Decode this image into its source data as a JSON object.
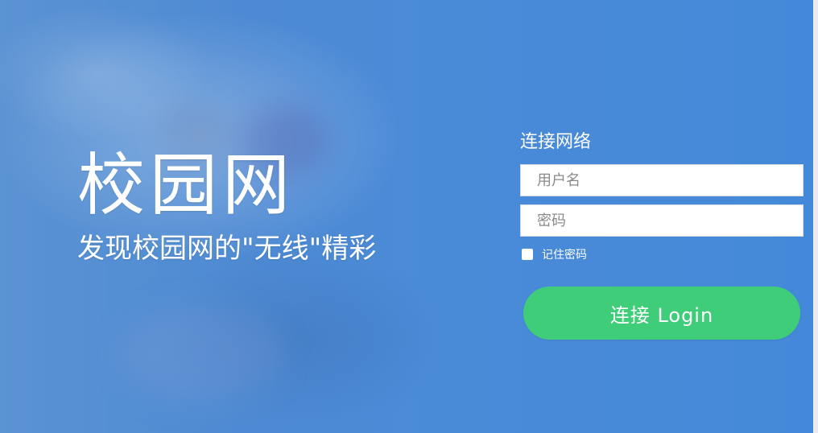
{
  "brand": {
    "title": "校园网",
    "slogan": "发现校园网的\"无线\"精彩"
  },
  "login": {
    "heading": "连接网络",
    "username_placeholder": "用户名",
    "password_placeholder": "密码",
    "remember_label": "记住密码",
    "remember_checked": false,
    "button_label": "连接 Login"
  },
  "colors": {
    "background": "#4a8bd8",
    "button": "#3fcd7a",
    "text": "#ffffff"
  }
}
